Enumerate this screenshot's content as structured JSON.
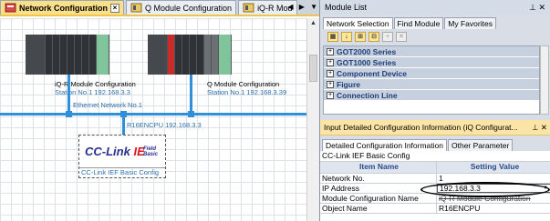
{
  "editor_tabs": [
    {
      "label": "Network Configuration",
      "active": true
    },
    {
      "label": "Q Module Configuration",
      "active": false
    },
    {
      "label": "iQ-R Mod",
      "active": false
    }
  ],
  "tab_nav": "◀ ▶ ▼",
  "canvas": {
    "module1": {
      "name": "iQ-R Module Configuration",
      "station": "Station No.1  192.168.3.3"
    },
    "module2": {
      "name": "Q Module Configuration",
      "station": "Station No.1  192.168.3.39"
    },
    "network_label": "Ethernet  Network No.1",
    "cpu_label": "R16ENCPU  192.168.3.3",
    "cc_logo": "CC-Link",
    "cc_ie": "IE",
    "cc_field": "Field",
    "cc_basic": "Basic",
    "cc_caption": "CC-Link IEF Basic Config"
  },
  "module_list": {
    "title": "Module List",
    "tabs": [
      "Network Selection",
      "Find Module",
      "My Favorites"
    ],
    "categories": [
      "GOT2000 Series",
      "GOT1000 Series",
      "Component Device",
      "Figure",
      "Connection Line"
    ]
  },
  "input_panel": {
    "title": "Input Detailed Configuration Information (iQ Configurat...",
    "tabs": [
      "Detailed Configuration Information",
      "Other Parameter"
    ],
    "subtitle": "CC-Link IEF Basic Config",
    "header": {
      "name": "Item Name",
      "value": "Setting Value"
    },
    "rows": [
      {
        "name": "Network No.",
        "value": "1"
      },
      {
        "name": "IP Address",
        "value": "192.168.3.3"
      },
      {
        "name": "Module Configuration Name",
        "value": "iQ-R Module Configuration"
      },
      {
        "name": "Object Name",
        "value": "R16ENCPU"
      }
    ]
  },
  "colors": {
    "accent": "#2f8fd8",
    "tab_active": "#fbe08a",
    "header_blue": "#2a4a8a"
  }
}
